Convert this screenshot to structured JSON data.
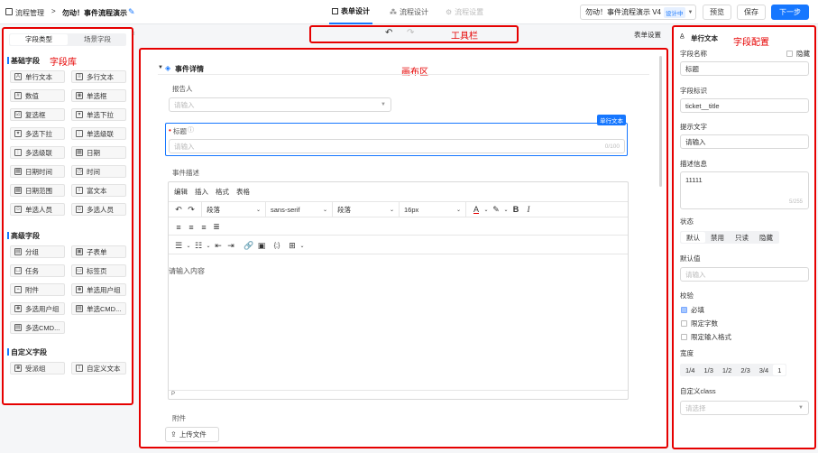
{
  "header": {
    "breadcrumb_root": "流程管理",
    "breadcrumb_sep": ">",
    "breadcrumb_current": "勿动！事件流程演示",
    "tabs": [
      {
        "label": "表单设计"
      },
      {
        "label": "流程设计"
      },
      {
        "label": "流程设置"
      }
    ],
    "version_label": "勿动！事件流程演示 V4",
    "version_badge": "设计中",
    "preview": "预览",
    "save": "保存",
    "next": "下一步"
  },
  "left": {
    "tabs": [
      "字段类型",
      "场景字段"
    ],
    "annotation": "字段库",
    "groups": [
      {
        "title": "基础字段",
        "items": [
          "单行文本",
          "多行文本",
          "数值",
          "单选框",
          "复选框",
          "单选下拉",
          "多选下拉",
          "单选级联",
          "多选级联",
          "日期",
          "日期时间",
          "时间",
          "日期范围",
          "富文本",
          "单选人员",
          "多选人员"
        ]
      },
      {
        "title": "高级字段",
        "items": [
          "分组",
          "子表单",
          "任务",
          "标签页",
          "附件",
          "单选用户组",
          "多选用户组",
          "单选CMD...",
          "多选CMD..."
        ]
      },
      {
        "title": "自定义字段",
        "items": [
          "受派组",
          "自定义文本"
        ]
      }
    ]
  },
  "toolbar": {
    "annotation": "工具栏",
    "form_settings": "表单设置"
  },
  "canvas": {
    "annotation": "画布区",
    "section_title": "事件详情",
    "reporter_label": "报告人",
    "reporter_placeholder": "请输入",
    "selected_badge": "单行文本",
    "title_label": "标题",
    "title_placeholder": "请输入",
    "title_count": "0/100",
    "desc_label": "事件描述",
    "menu": [
      "编辑",
      "插入",
      "格式",
      "表格"
    ],
    "block1": "段落",
    "font": "sans-serif",
    "block2": "段落",
    "size": "16px",
    "editor_placeholder": "请输入内容",
    "status_path": "P",
    "attach_label": "附件",
    "upload": "上传文件"
  },
  "right": {
    "header": "单行文本",
    "annotation": "字段配置",
    "name_label": "字段名称",
    "hide_label": "隐藏",
    "name_value": "标题",
    "key_label": "字段标识",
    "key_value": "ticket__title",
    "hint_label": "提示文字",
    "hint_value": "请输入",
    "desc_label": "描述信息",
    "desc_value": "11111",
    "desc_count": "5/255",
    "state_label": "状态",
    "states": [
      "默认",
      "禁用",
      "只读",
      "隐藏"
    ],
    "default_label": "默认值",
    "default_placeholder": "请输入",
    "valid_label": "校验",
    "validations": [
      "必填",
      "限定字数",
      "限定输入格式"
    ],
    "width_label": "宽度",
    "widths": [
      "1/4",
      "1/3",
      "1/2",
      "2/3",
      "3/4",
      "1"
    ],
    "class_label": "自定义class",
    "class_placeholder": "请选择"
  }
}
